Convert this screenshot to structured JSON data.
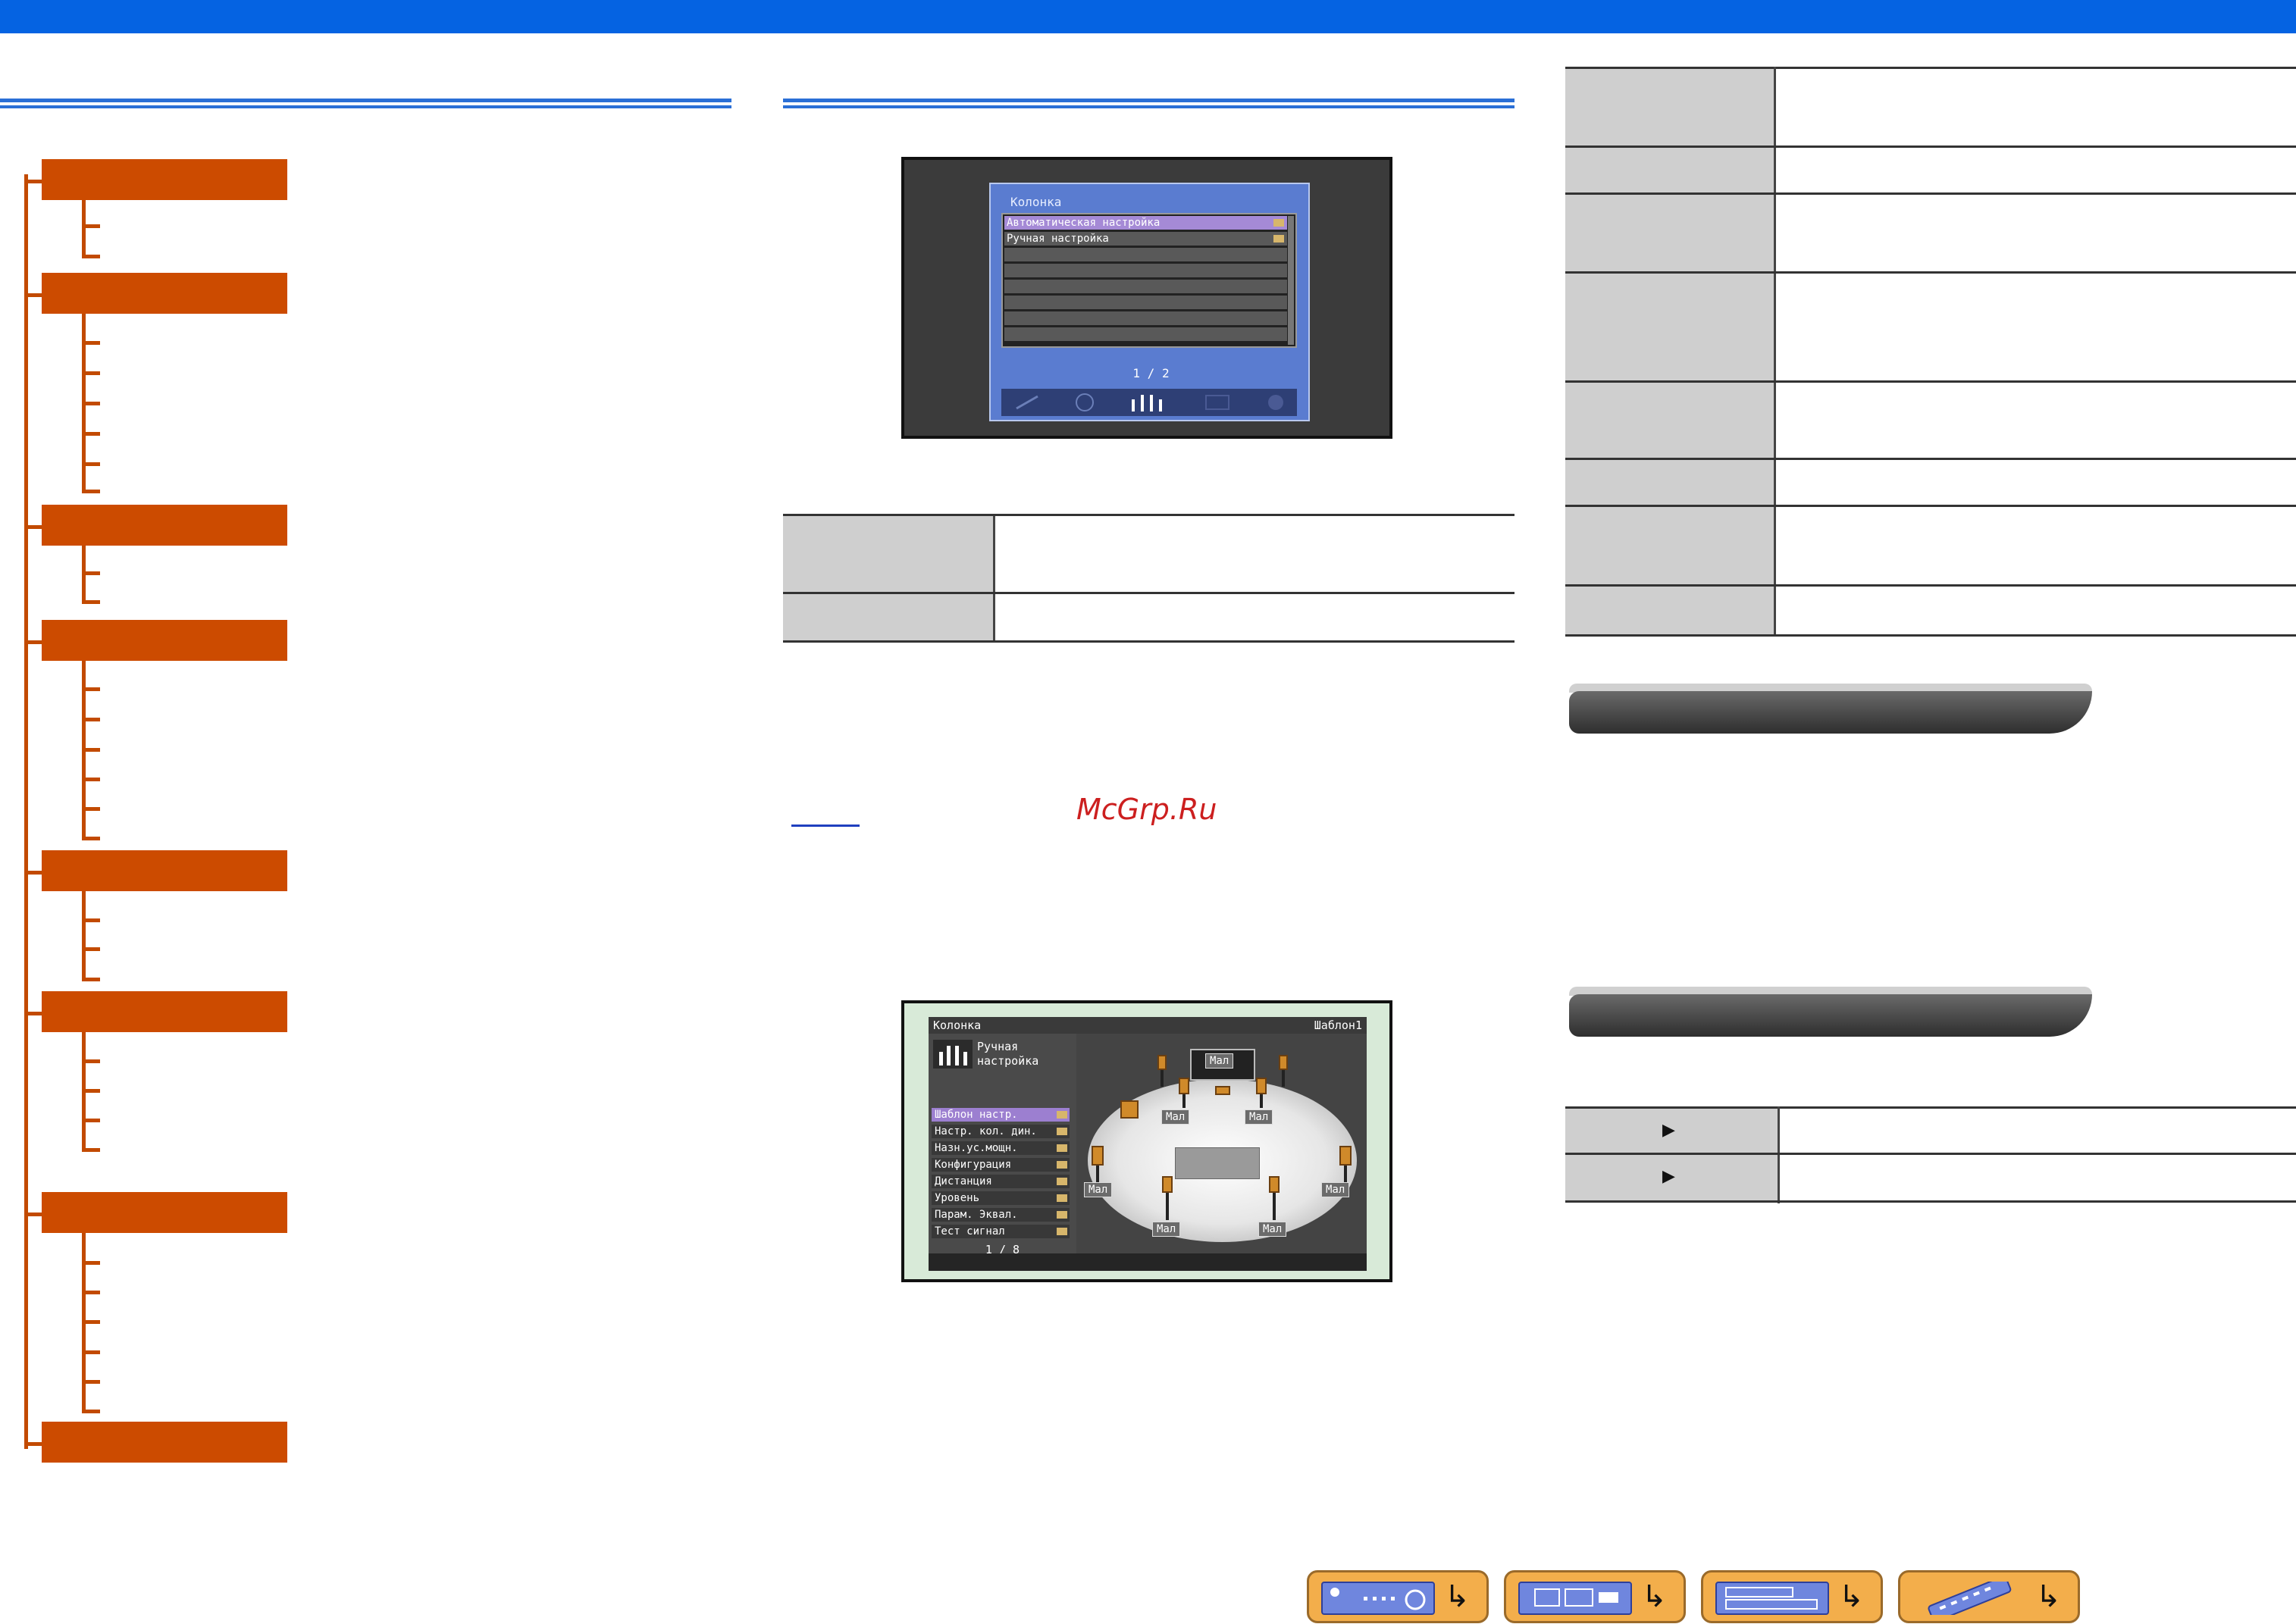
{
  "screen1": {
    "title": "Колонка",
    "items": [
      {
        "label": "Автоматическая настройка",
        "selected": true
      },
      {
        "label": "Ручная настройка",
        "selected": false
      }
    ],
    "page": "1 / 2"
  },
  "screen2": {
    "title": "Колонка",
    "pattern": "Шаблон1",
    "section_line1": "Ручная",
    "section_line2": "настройка",
    "menu": [
      {
        "label": "Шаблон настр.",
        "selected": true
      },
      {
        "label": "Настр. кол. дин.",
        "selected": false
      },
      {
        "label": "Назн.ус.мощн.",
        "selected": false
      },
      {
        "label": "Конфигурация",
        "selected": false
      },
      {
        "label": "Дистанция",
        "selected": false
      },
      {
        "label": "Уровень",
        "selected": false
      },
      {
        "label": "Парам. Эквал.",
        "selected": false
      },
      {
        "label": "Тест сигнал",
        "selected": false
      }
    ],
    "page": "1 / 8",
    "speaker_labels": {
      "center": "Мал",
      "front_l": "Мал",
      "front_r": "Мал",
      "surround_l": "Мал",
      "surround_r": "Мал",
      "back_l": "Мал",
      "back_r": "Мал"
    }
  },
  "right_table_rows": [
    {
      "label": "",
      "value": ""
    },
    {
      "label": "",
      "value": ""
    },
    {
      "label": "",
      "value": ""
    },
    {
      "label": "",
      "value": ""
    },
    {
      "label": "",
      "value": ""
    },
    {
      "label": "",
      "value": ""
    },
    {
      "label": "",
      "value": ""
    },
    {
      "label": "",
      "value": ""
    }
  ],
  "nav_arrow_glyph": "▶",
  "return_glyph": "↳",
  "watermark": "McGrp.Ru",
  "colors": {
    "header_blue": "#0563e2",
    "menu_orange": "#cc4b00",
    "nav_button": "#f3ae4b"
  }
}
